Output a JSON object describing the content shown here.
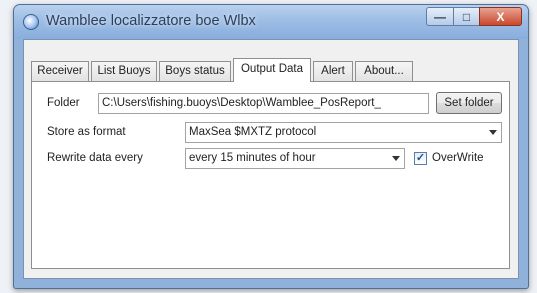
{
  "window": {
    "title": "Wamblee localizzatore boe Wlbx",
    "minimize_label": "—",
    "maximize_label": "□",
    "close_label": "X"
  },
  "tabs": [
    "Receiver",
    "List Buoys",
    "Boys status",
    "Output Data",
    "Alert",
    "About..."
  ],
  "active_tab": "Output Data",
  "output_data": {
    "folder_label": "Folder",
    "folder_value": "C:\\Users\\fishing.buoys\\Desktop\\Wamblee_PosReport_",
    "set_folder_button": "Set folder",
    "store_format_label": "Store as format",
    "store_format_value": "MaxSea $MXTZ protocol",
    "rewrite_label": "Rewrite data every",
    "rewrite_value": "every 15 minutes of hour",
    "overwrite_label": "OverWrite",
    "overwrite_checked": true,
    "overwrite_checkmark": "✓"
  }
}
